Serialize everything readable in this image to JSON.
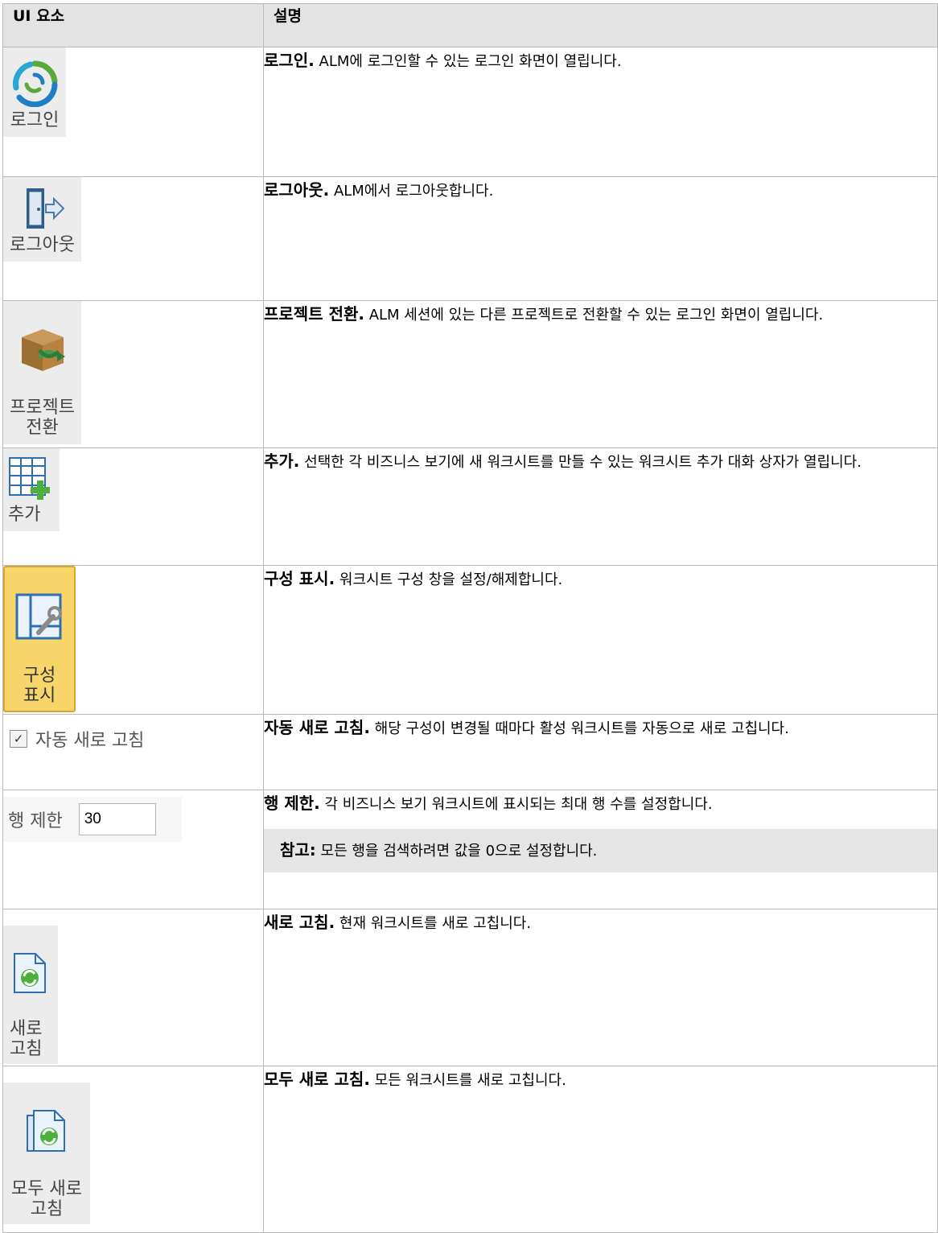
{
  "header": {
    "col1": "UI 요소",
    "col2": "설명"
  },
  "rows": [
    {
      "icon": "login-icon",
      "label": "로그인",
      "title": "로그인.",
      "desc": "ALM에 로그인할 수 있는 로그인 화면이 열립니다."
    },
    {
      "icon": "logout-door-icon",
      "label": "로그아웃",
      "title": "로그아웃.",
      "desc": "ALM에서 로그아웃합니다."
    },
    {
      "icon": "switch-project-box-icon",
      "label": "프로젝트\n전환",
      "title": "프로젝트 전환.",
      "desc": "ALM 세션에 있는 다른 프로젝트로 전환할 수 있는 로그인 화면이 열립니다."
    },
    {
      "icon": "add-worksheet-icon",
      "label": "추가",
      "title": "추가.",
      "desc": "선택한 각 비즈니스 보기에 새 워크시트를 만들 수 있는 워크시트 추가 대화 상자가 열립니다."
    },
    {
      "icon": "show-configuration-icon",
      "label": "구성\n표시",
      "title": "구성 표시.",
      "desc": "워크시트 구성 창을 설정/해제합니다."
    },
    {
      "icon": "checkbox-checked-icon",
      "label": "자동 새로 고침",
      "title": "자동 새로 고침.",
      "desc": "해당 구성이 변경될 때마다 활성 워크시트를 자동으로 새로 고칩니다."
    },
    {
      "label": "행 제한",
      "value": "30",
      "title": "행 제한.",
      "desc": "각 비즈니스 보기 워크시트에 표시되는 최대 행 수를 설정합니다.",
      "note_title": "참고:",
      "note_text": "모든 행을 검색하려면 값을 0으로 설정합니다."
    },
    {
      "icon": "refresh-page-icon",
      "label": "새로\n고침",
      "title": "새로 고침.",
      "desc": "현재 워크시트를 새로 고칩니다."
    },
    {
      "icon": "refresh-all-pages-icon",
      "label": "모두 새로\n고침",
      "title": "모두 새로 고침.",
      "desc": "모든 워크시트를 새로 고칩니다."
    }
  ],
  "colors": {
    "header_bg": "#e3e3e3",
    "border": "#b9b9b9",
    "note_bg": "#e5e5e5",
    "gold": "#f7d56a"
  }
}
